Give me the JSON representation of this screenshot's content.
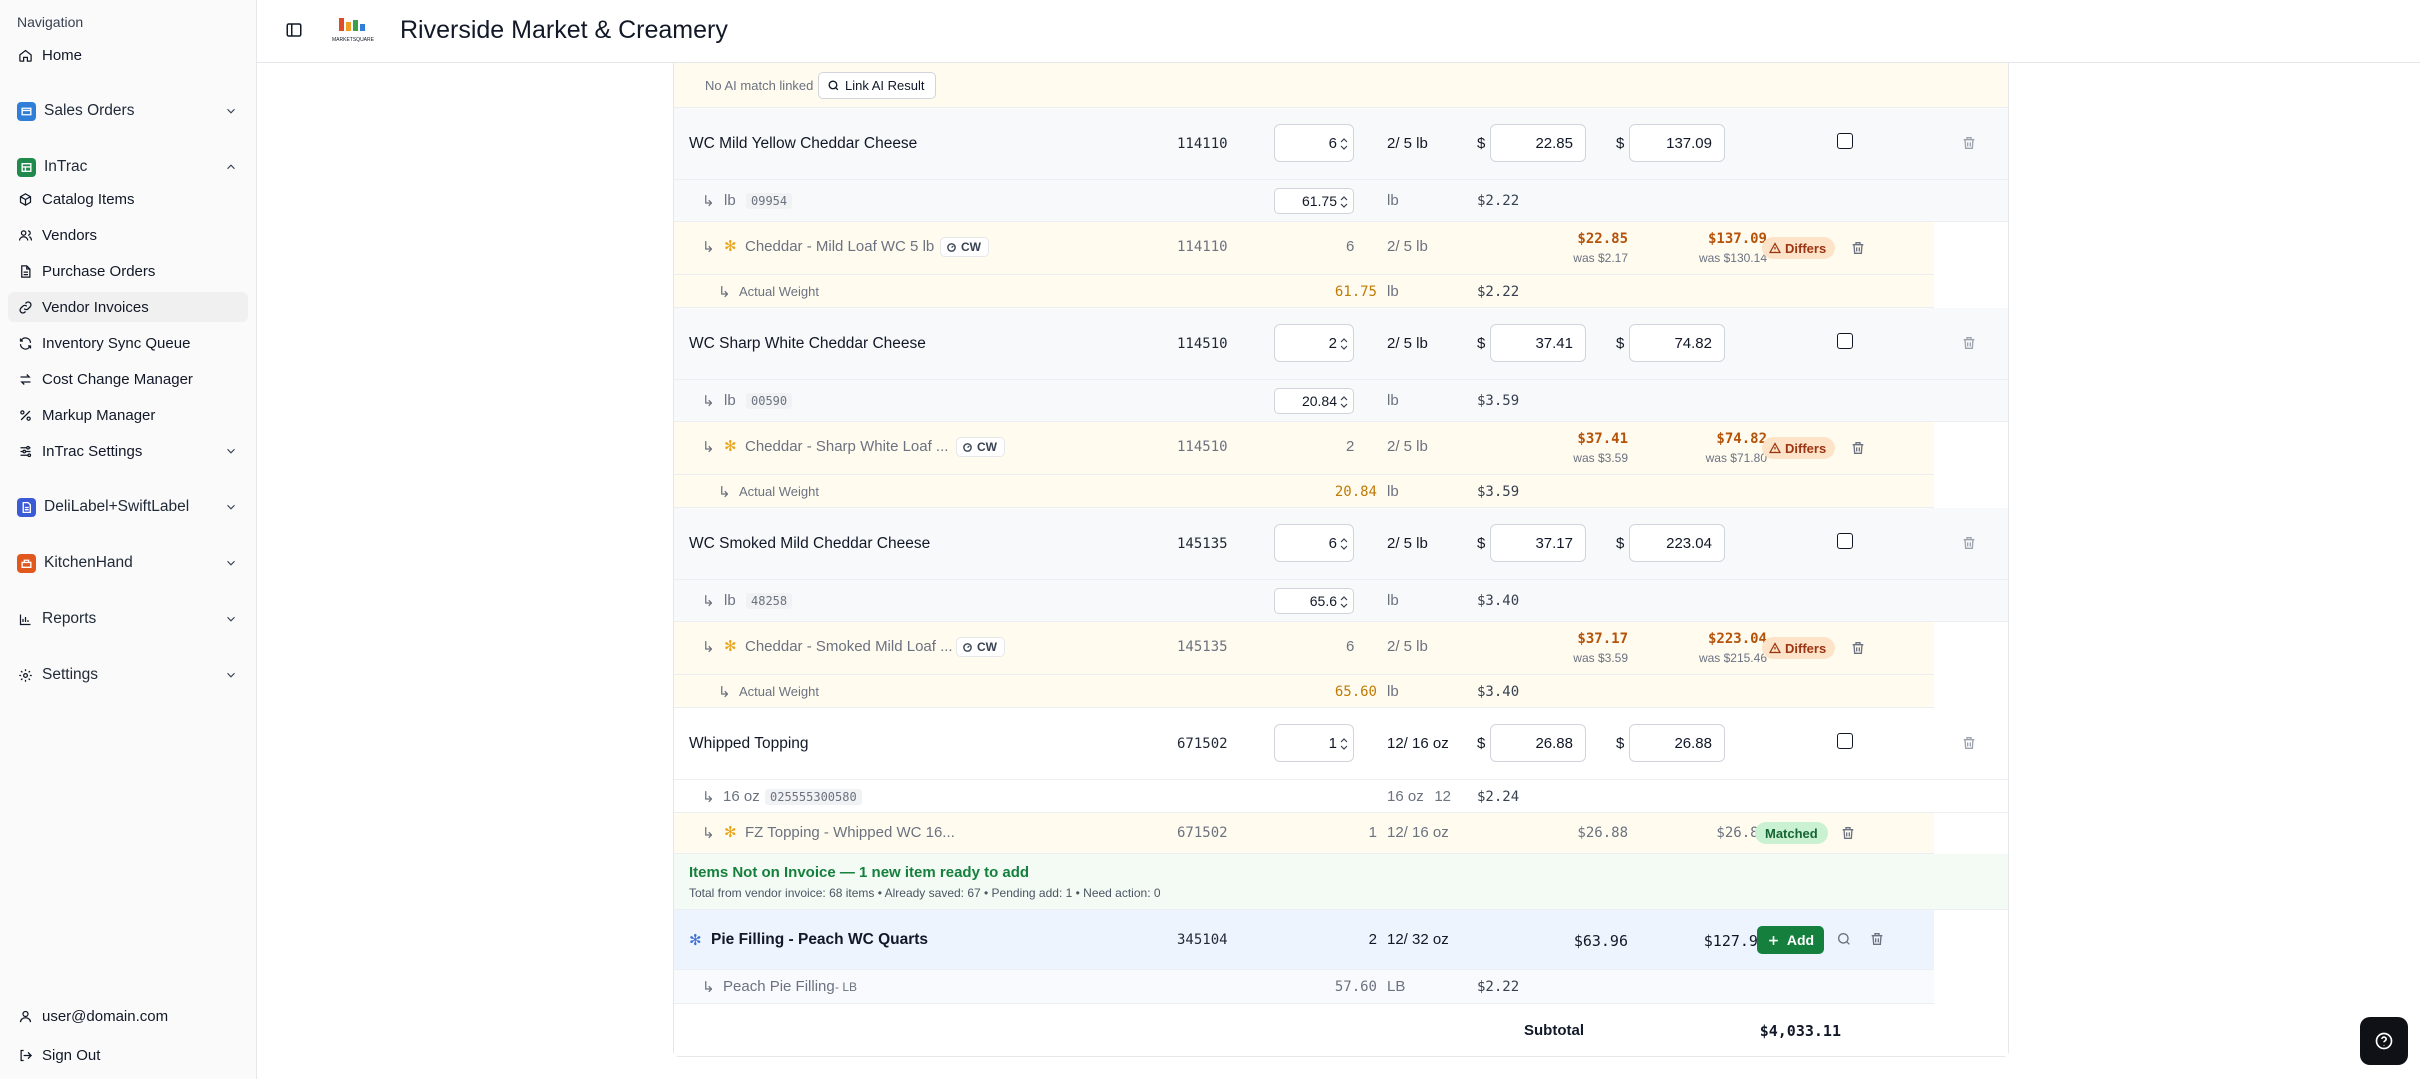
{
  "sidebar": {
    "caption": "Navigation",
    "home": "Home",
    "groups": {
      "sales_orders": "Sales Orders",
      "intrac": "InTrac",
      "delilabel": "DeliLabel+SwiftLabel",
      "kitchenhand": "KitchenHand"
    },
    "intrac_items": [
      "Catalog Items",
      "Vendors",
      "Purchase Orders",
      "Vendor Invoices",
      "Inventory Sync Queue",
      "Cost Change Manager",
      "Markup Manager",
      "InTrac Settings"
    ],
    "reports": "Reports",
    "settings": "Settings",
    "user_email": "user@domain.com",
    "sign_out": "Sign Out",
    "colors": {
      "sales": "#2f7fd8",
      "intrac": "#1f8a4c",
      "delilabel": "#3b5bd6",
      "kitchenhand": "#e0581d"
    },
    "active_item": "Vendor Invoices"
  },
  "header": {
    "logo_text": "MARKETSQUARE",
    "title": "Riverside Market & Creamery"
  },
  "top_match": {
    "no_match_text": "No AI match linked",
    "link_button": "Link AI Result"
  },
  "items": [
    {
      "name": "WC Mild Yellow Cheddar Cheese",
      "code": "114110",
      "qty": "6",
      "pack": "2/ 5 lb",
      "currency": "$",
      "cost": "22.85",
      "ext": "137.09",
      "unit": {
        "label": "lb",
        "sku": "09954",
        "weight": "61.75",
        "unit2": "lb",
        "price": "$2.22"
      },
      "ai": {
        "name": "Cheddar - Mild Loaf WC 5 lb",
        "badge": "CW",
        "code": "114110",
        "qty": "6",
        "pack": "2/ 5 lb",
        "cost": "$22.85",
        "cost_was": "was $2.17",
        "ext": "$137.09",
        "ext_was": "was $130.14",
        "status": "Differs"
      },
      "actual": {
        "label": "Actual Weight",
        "value": "61.75",
        "unit": "lb",
        "price": "$2.22"
      }
    },
    {
      "name": "WC Sharp White Cheddar Cheese",
      "code": "114510",
      "qty": "2",
      "pack": "2/ 5 lb",
      "currency": "$",
      "cost": "37.41",
      "ext": "74.82",
      "unit": {
        "label": "lb",
        "sku": "00590",
        "weight": "20.84",
        "unit2": "lb",
        "price": "$3.59"
      },
      "ai": {
        "name": "Cheddar - Sharp White Loaf ...",
        "badge": "CW",
        "code": "114510",
        "qty": "2",
        "pack": "2/ 5 lb",
        "cost": "$37.41",
        "cost_was": "was $3.59",
        "ext": "$74.82",
        "ext_was": "was $71.80",
        "status": "Differs"
      },
      "actual": {
        "label": "Actual Weight",
        "value": "20.84",
        "unit": "lb",
        "price": "$3.59"
      }
    },
    {
      "name": "WC Smoked Mild Cheddar Cheese",
      "code": "145135",
      "qty": "6",
      "pack": "2/ 5 lb",
      "currency": "$",
      "cost": "37.17",
      "ext": "223.04",
      "unit": {
        "label": "lb",
        "sku": "48258",
        "weight": "65.6",
        "unit2": "lb",
        "price": "$3.40"
      },
      "ai": {
        "name": "Cheddar - Smoked Mild Loaf ...",
        "badge": "CW",
        "code": "145135",
        "qty": "6",
        "pack": "2/ 5 lb",
        "cost": "$37.17",
        "cost_was": "was $3.59",
        "ext": "$223.04",
        "ext_was": "was $215.46",
        "status": "Differs"
      },
      "actual": {
        "label": "Actual Weight",
        "value": "65.60",
        "unit": "lb",
        "price": "$3.40"
      }
    }
  ],
  "whipped": {
    "name": "Whipped Topping",
    "code": "671502",
    "qty": "1",
    "pack": "12/ 16 oz",
    "currency": "$",
    "cost": "26.88",
    "ext": "26.88",
    "unit": {
      "label": "16 oz",
      "sku": "025555300580",
      "count": "12",
      "unit2": "16 oz",
      "price": "$2.24"
    },
    "ai": {
      "name": "FZ Topping - Whipped WC 16...",
      "code": "671502",
      "qty": "1",
      "pack": "12/ 16 oz",
      "cost": "$26.88",
      "ext": "$26.88",
      "status": "Matched"
    }
  },
  "not_on_invoice": {
    "title": "Items Not on Invoice — 1 new item ready to add",
    "summary": "Total from vendor invoice: 68 items • Already saved: 67 • Pending add: 1 • Need action: 0"
  },
  "new_item": {
    "name": "Pie Filling - Peach WC Quarts",
    "code": "345104",
    "qty": "2",
    "pack": "12/ 32 oz",
    "cost": "$63.96",
    "ext": "$127.92",
    "add_button": "Add",
    "sub": {
      "name": "Peach Pie Filling",
      "unit_tag": "- LB",
      "weight": "57.60",
      "unit": "LB",
      "price": "$2.22"
    }
  },
  "subtotal": {
    "label": "Subtotal",
    "value": "$4,033.11"
  }
}
